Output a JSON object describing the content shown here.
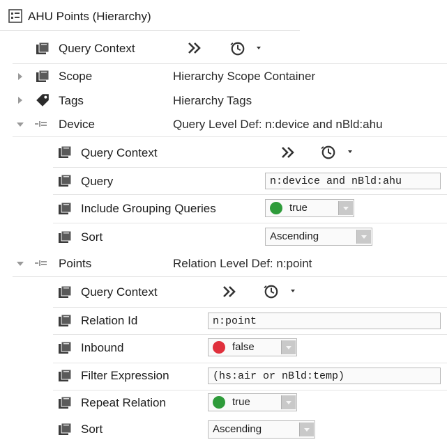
{
  "title": {
    "icon": "hierarchy-icon",
    "text": "AHU Points  (Hierarchy)"
  },
  "top_query_context": {
    "label": "Query Context",
    "icon": "query-context-icon"
  },
  "scope": {
    "label": "Scope",
    "value": "Hierarchy Scope Container",
    "icon": "query-context-icon"
  },
  "tags": {
    "label": "Tags",
    "value": "Hierarchy Tags",
    "icon": "tag-icon"
  },
  "device": {
    "label": "Device",
    "value": "Query Level Def:  n:device and nBld:ahu",
    "icon": "level-def-icon",
    "query_context": {
      "label": "Query Context"
    },
    "query": {
      "label": "Query",
      "value": "n:device and nBld:ahu"
    },
    "include_grouping": {
      "label": "Include Grouping Queries",
      "value": "true",
      "color": "#2e9b3a"
    },
    "sort": {
      "label": "Sort",
      "value": "Ascending"
    }
  },
  "points": {
    "label": "Points",
    "value": "Relation Level Def:  n:point",
    "icon": "level-def-icon",
    "query_context": {
      "label": "Query Context"
    },
    "relation_id": {
      "label": "Relation Id",
      "value": "n:point"
    },
    "inbound": {
      "label": "Inbound",
      "value": "false",
      "color": "#e0303c"
    },
    "filter_expression": {
      "label": "Filter Expression",
      "value": "(hs:air or nBld:temp)"
    },
    "repeat_relation": {
      "label": "Repeat Relation",
      "value": "true",
      "color": "#2e9b3a"
    },
    "sort": {
      "label": "Sort",
      "value": "Ascending"
    }
  },
  "icons": {
    "forward": "double-chevron-icon",
    "clock": "clock-icon",
    "dropdown": "chevron-down-icon"
  }
}
